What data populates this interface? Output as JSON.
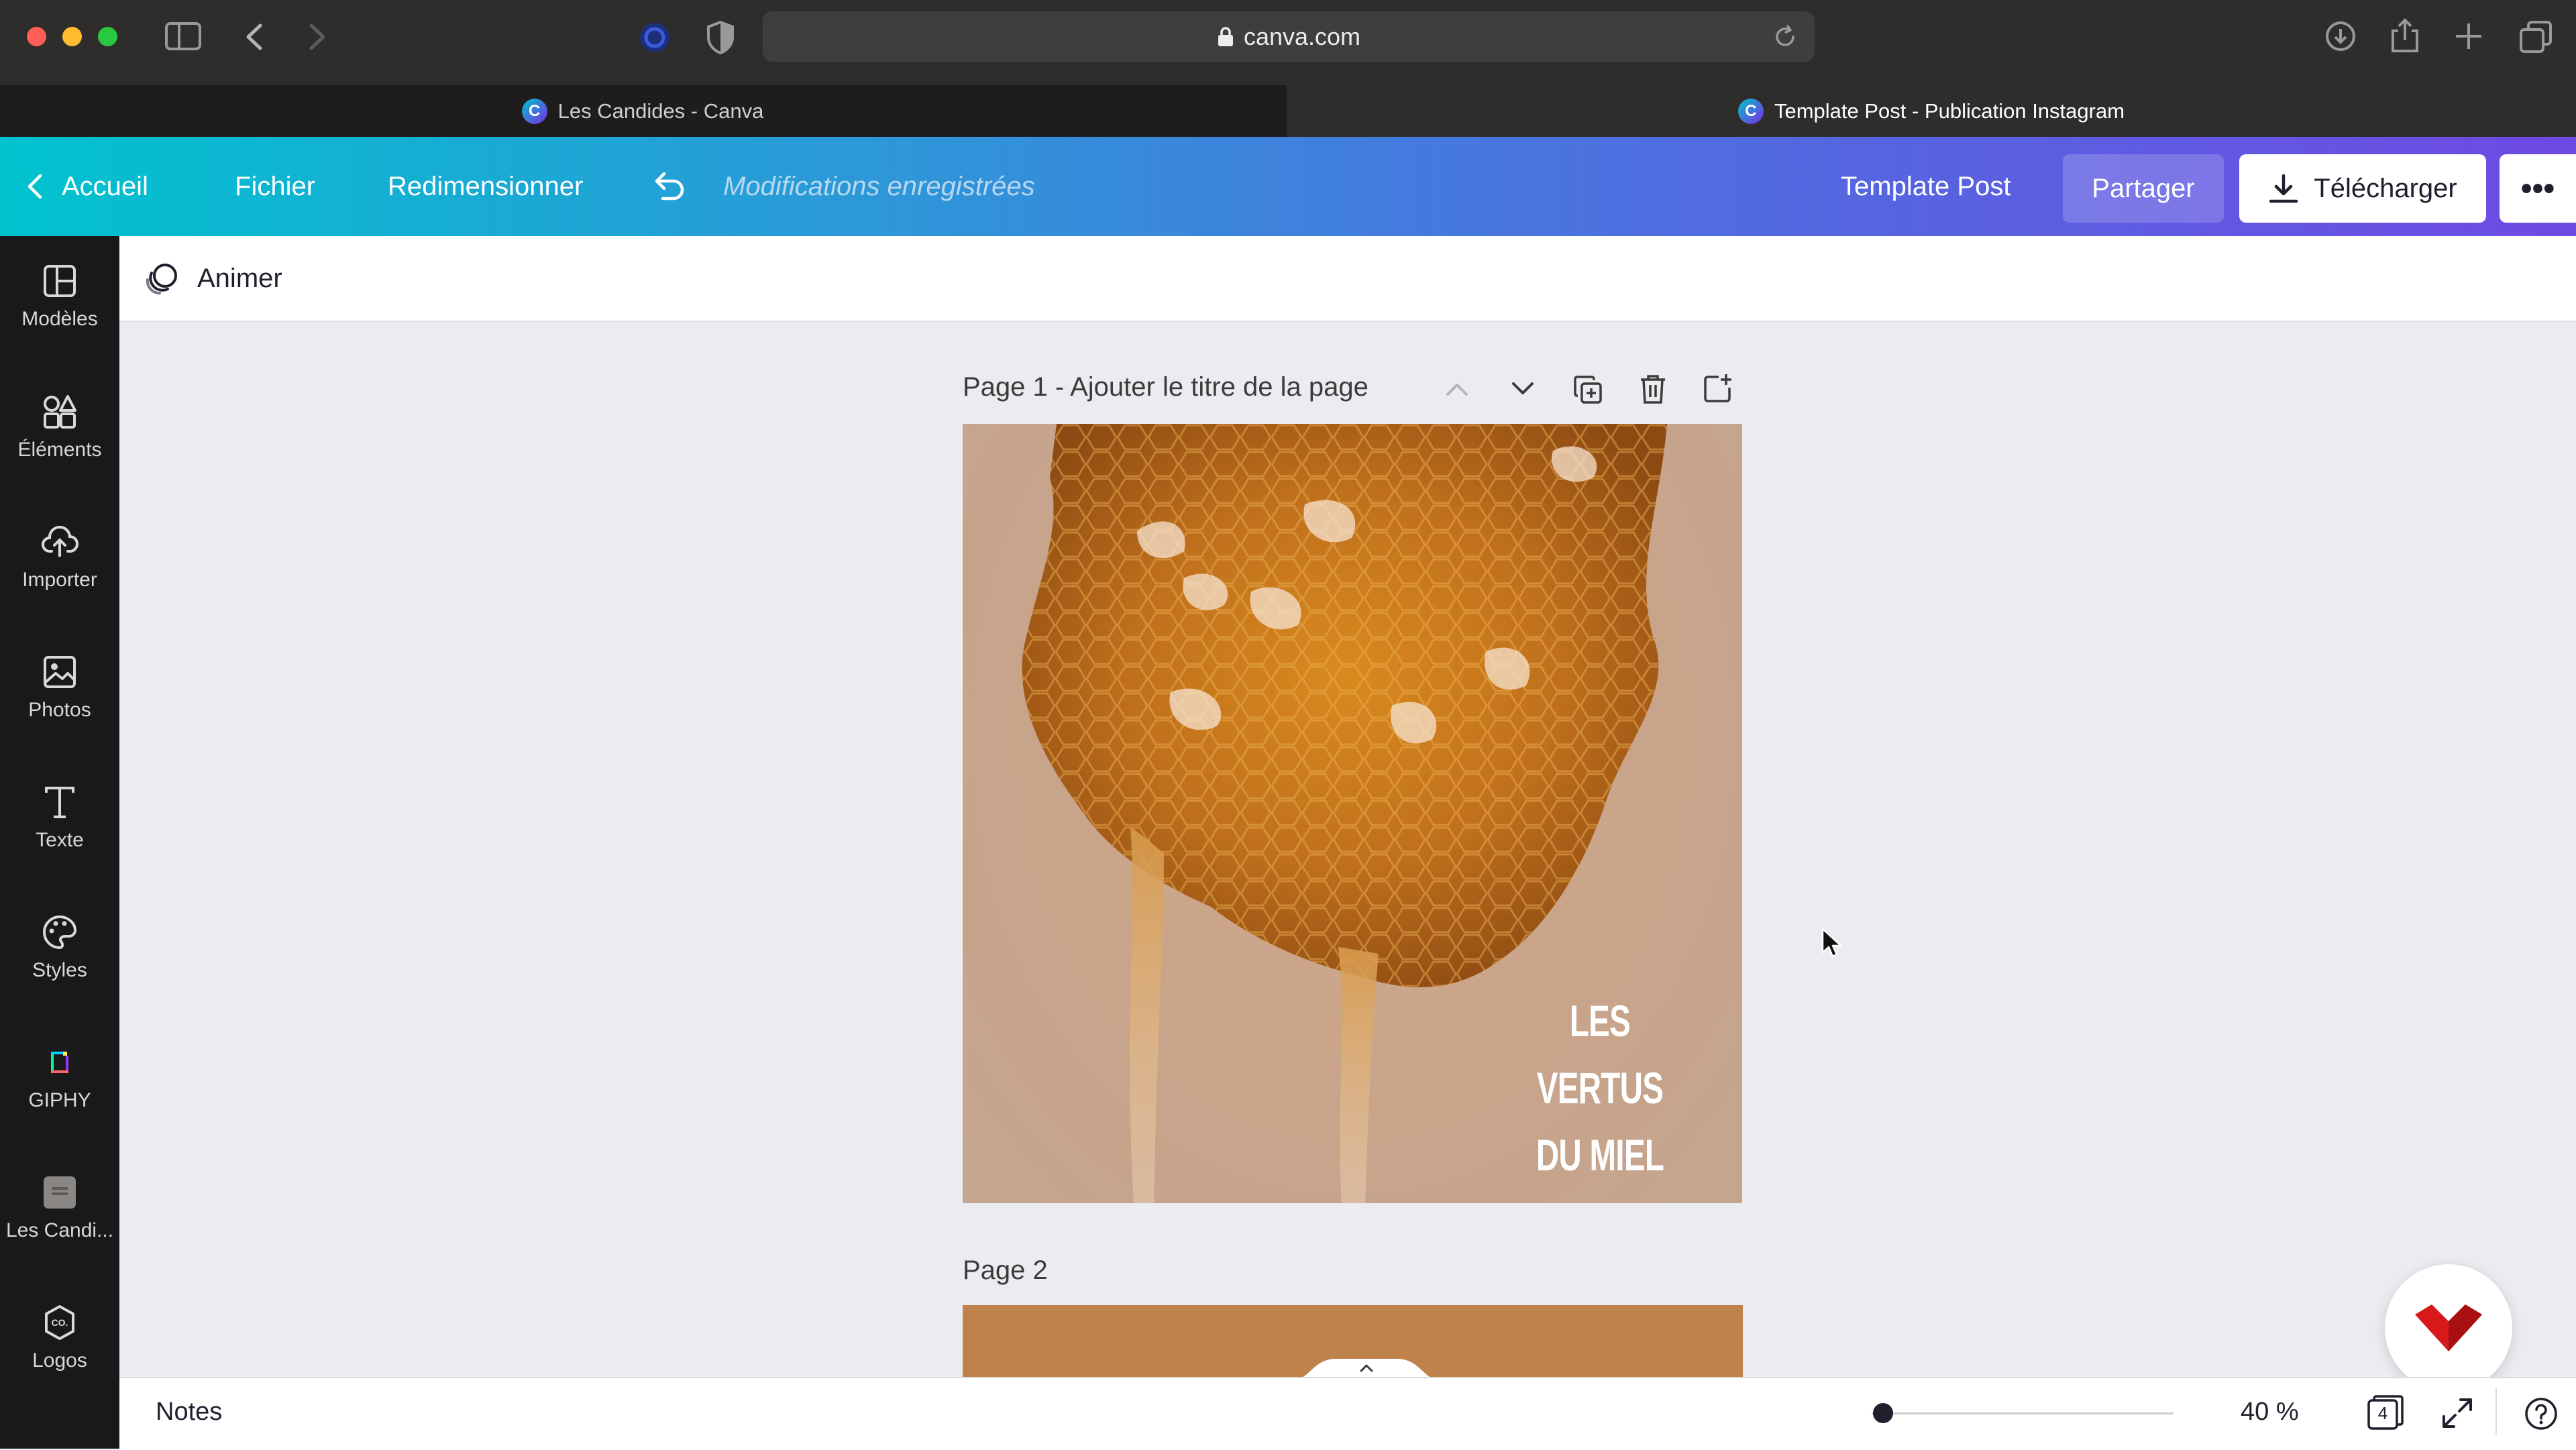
{
  "browser": {
    "url": "canva.com",
    "tabs": [
      {
        "label": "Les Candides - Canva",
        "favicon": "C"
      },
      {
        "label": "Template Post - Publication Instagram",
        "favicon": "C"
      }
    ]
  },
  "header": {
    "home_label": "Accueil",
    "file_label": "Fichier",
    "resize_label": "Redimensionner",
    "status": "Modifications enregistrées",
    "doc_title": "Template Post",
    "share_label": "Partager",
    "download_label": "Télécharger"
  },
  "sidebar": {
    "items": [
      {
        "label": "Modèles",
        "icon": "templates-icon"
      },
      {
        "label": "Éléments",
        "icon": "elements-icon"
      },
      {
        "label": "Importer",
        "icon": "upload-icon"
      },
      {
        "label": "Photos",
        "icon": "photos-icon"
      },
      {
        "label": "Texte",
        "icon": "text-icon"
      },
      {
        "label": "Styles",
        "icon": "palette-icon"
      },
      {
        "label": "GIPHY",
        "icon": "giphy-icon"
      },
      {
        "label": "Les Candi...",
        "icon": "folder-icon"
      },
      {
        "label": "Logos",
        "icon": "logos-icon"
      }
    ]
  },
  "toolbar": {
    "animate_label": "Animer"
  },
  "canvas": {
    "page1_label": "Page 1 - Ajouter le titre de la page",
    "page1_text_line1": "LES VERTUS",
    "page1_text_line2": "DU MIEL",
    "page2_label": "Page 2"
  },
  "footer": {
    "notes_label": "Notes",
    "zoom": "40 %",
    "page_count": "4"
  },
  "colors": {
    "accent_purple": "#7d2ae8",
    "header_start": "#00c3ce",
    "header_end": "#6e4ae3",
    "page2_bg": "#c0824b"
  }
}
